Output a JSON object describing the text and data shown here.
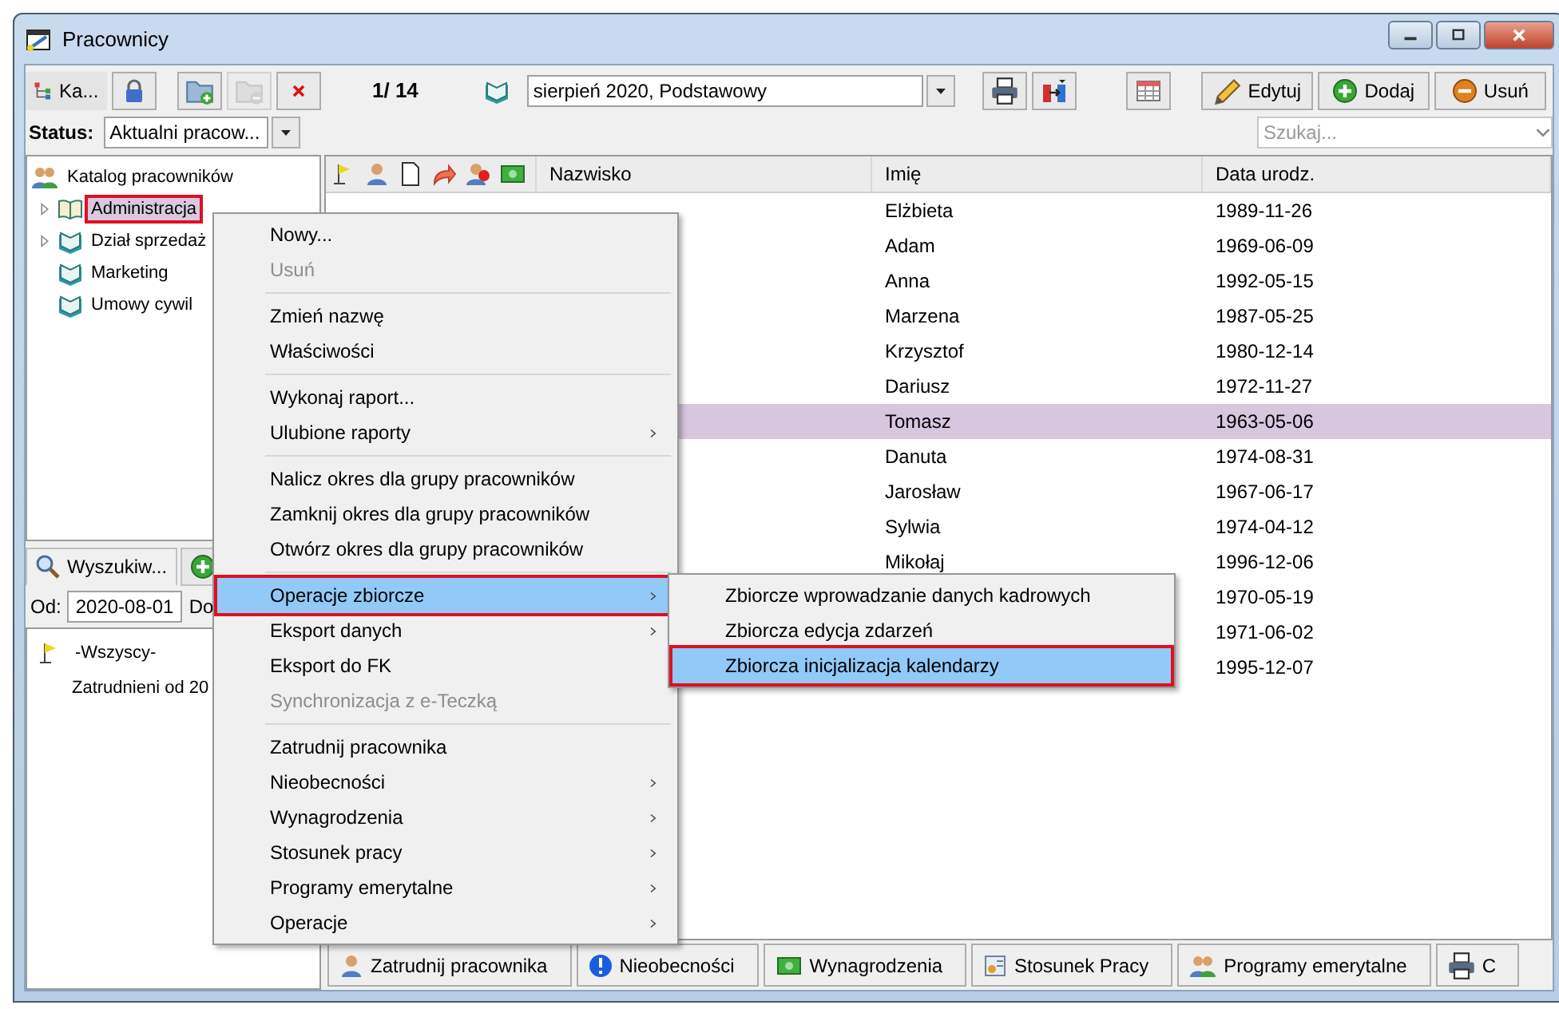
{
  "window": {
    "title": "Pracownicy"
  },
  "left_toolbar": [
    {
      "kind": "catalog",
      "label": "Ka...",
      "disabled": false
    },
    {
      "kind": "lock",
      "disabled": false
    },
    {
      "kind": "folder_add",
      "disabled": false
    },
    {
      "kind": "folder_remove",
      "disabled": true
    },
    {
      "kind": "delete",
      "disabled": false
    }
  ],
  "record_counter": "1/ 14",
  "period": {
    "value": "sierpień 2020, Podstawowy"
  },
  "right_toolbar": [
    {
      "kind": "print"
    },
    {
      "kind": "export"
    },
    {
      "kind": "columns"
    },
    {
      "kind": "edit",
      "label": "Edytuj"
    },
    {
      "kind": "add",
      "label": "Dodaj"
    },
    {
      "kind": "remove",
      "label": "Usuń"
    }
  ],
  "status": {
    "label": "Status:",
    "value": "Aktualni pracow..."
  },
  "search": {
    "placeholder": "Szukaj..."
  },
  "tree": {
    "root": "Katalog pracowników",
    "children": [
      {
        "label": "Administracja",
        "expandable": true,
        "selected": true,
        "marked": true
      },
      {
        "label": "Dział sprzedaż",
        "expandable": true,
        "selected": false,
        "marked": false
      },
      {
        "label": "Marketing",
        "expandable": false,
        "selected": false,
        "marked": false
      },
      {
        "label": "Umowy cywil",
        "expandable": false,
        "selected": false,
        "marked": false
      }
    ]
  },
  "search_tabs": [
    {
      "kind": "search",
      "label": "Wyszukiw...",
      "selected": true
    },
    {
      "kind": "add",
      "selected": false
    }
  ],
  "filter": {
    "from_label": "Od:",
    "from_value": "2020-08-01",
    "to_label": "Do"
  },
  "saved_searches": [
    {
      "kind": "flag",
      "label": "-Wszyscy-"
    },
    {
      "kind": "plain",
      "label": "Zatrudnieni od 20"
    }
  ],
  "table": {
    "columns": [
      "Nazwisko",
      "Imię",
      "Data urodz."
    ],
    "rows": [
      {
        "first_name": "Elżbieta",
        "birth_date": "1989-11-26",
        "selected": false
      },
      {
        "first_name": "Adam",
        "birth_date": "1969-06-09",
        "selected": false
      },
      {
        "first_name": "Anna",
        "birth_date": "1992-05-15",
        "selected": false
      },
      {
        "first_name": "Marzena",
        "birth_date": "1987-05-25",
        "selected": false
      },
      {
        "first_name": "Krzysztof",
        "birth_date": "1980-12-14",
        "selected": false
      },
      {
        "first_name": "Dariusz",
        "birth_date": "1972-11-27",
        "selected": false
      },
      {
        "first_name": "Tomasz",
        "birth_date": "1963-05-06",
        "selected": true
      },
      {
        "first_name": "Danuta",
        "birth_date": "1974-08-31",
        "selected": false
      },
      {
        "first_name": "Jarosław",
        "birth_date": "1967-06-17",
        "selected": false
      },
      {
        "first_name": "Sylwia",
        "birth_date": "1974-04-12",
        "selected": false
      },
      {
        "first_name": "Mikołaj",
        "birth_date": "1996-12-06",
        "selected": false
      },
      {
        "birth_date": "1970-05-19",
        "selected": false
      },
      {
        "birth_date": "1971-06-02",
        "selected": false
      },
      {
        "birth_date": "1995-12-07",
        "selected": false
      }
    ]
  },
  "bottom_buttons": [
    "Zatrudnij pracownika",
    "Nieobecności",
    "Wynagrodzenia",
    "Stosunek Pracy",
    "Programy emerytalne",
    "C"
  ],
  "context_menu": {
    "groups": [
      [
        {
          "label": "Nowy...",
          "disabled": false,
          "submenu": false,
          "selected": false,
          "marked": false
        },
        {
          "label": "Usuń",
          "disabled": true,
          "submenu": false,
          "selected": false,
          "marked": false
        }
      ],
      [
        {
          "label": "Zmień nazwę",
          "disabled": false,
          "submenu": false,
          "selected": false,
          "marked": false
        },
        {
          "label": "Właściwości",
          "disabled": false,
          "submenu": false,
          "selected": false,
          "marked": false
        }
      ],
      [
        {
          "label": "Wykonaj raport...",
          "disabled": false,
          "submenu": false,
          "selected": false,
          "marked": false
        },
        {
          "label": "Ulubione raporty",
          "disabled": false,
          "submenu": true,
          "selected": false,
          "marked": false
        }
      ],
      [
        {
          "label": "Nalicz okres dla grupy pracowników",
          "disabled": false,
          "submenu": false,
          "selected": false,
          "marked": false
        },
        {
          "label": "Zamknij okres dla grupy pracowników",
          "disabled": false,
          "submenu": false,
          "selected": false,
          "marked": false
        },
        {
          "label": "Otwórz okres dla grupy pracowników",
          "disabled": false,
          "submenu": false,
          "selected": false,
          "marked": false
        }
      ],
      [
        {
          "label": "Operacje zbiorcze",
          "disabled": false,
          "submenu": true,
          "selected": true,
          "marked": true
        },
        {
          "label": "Eksport danych",
          "disabled": false,
          "submenu": true,
          "selected": false,
          "marked": false
        },
        {
          "label": "Eksport do FK",
          "disabled": false,
          "submenu": false,
          "selected": false,
          "marked": false
        },
        {
          "label": "Synchronizacja z e-Teczką",
          "disabled": true,
          "submenu": false,
          "selected": false,
          "marked": false
        }
      ],
      [
        {
          "label": "Zatrudnij pracownika",
          "disabled": false,
          "submenu": false,
          "selected": false,
          "marked": false
        },
        {
          "label": "Nieobecności",
          "disabled": false,
          "submenu": true,
          "selected": false,
          "marked": false
        },
        {
          "label": "Wynagrodzenia",
          "disabled": false,
          "submenu": true,
          "selected": false,
          "marked": false
        },
        {
          "label": "Stosunek pracy",
          "disabled": false,
          "submenu": true,
          "selected": false,
          "marked": false
        },
        {
          "label": "Programy emerytalne",
          "disabled": false,
          "submenu": true,
          "selected": false,
          "marked": false
        },
        {
          "label": "Operacje",
          "disabled": false,
          "submenu": true,
          "selected": false,
          "marked": false
        }
      ]
    ]
  },
  "submenu": {
    "items": [
      {
        "label": "Zbiorcze wprowadzanie danych kadrowych",
        "selected": false,
        "marked": false
      },
      {
        "label": "Zbiorcza edycja zdarzeń",
        "selected": false,
        "marked": false
      },
      {
        "label": "Zbiorcza inicjalizacja kalendarzy",
        "selected": true,
        "marked": true
      }
    ]
  }
}
